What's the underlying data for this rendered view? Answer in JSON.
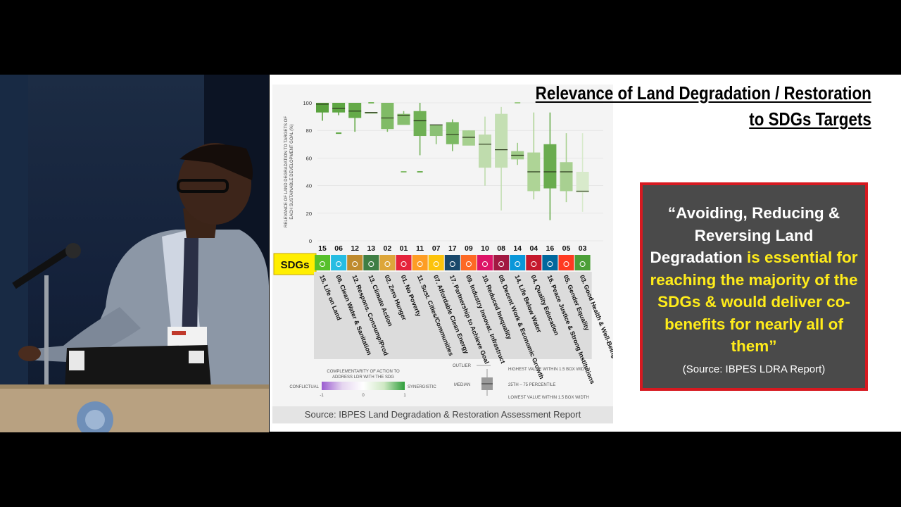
{
  "slide": {
    "title_line1": "Relevance of Land Degradation / Restoration",
    "title_line2": "to SDGs Targets",
    "source": "Source: IBPES Land Degradation & Restoration Assessment Report",
    "quote": {
      "white_part": "“Avoiding, Reducing & Reversing Land Degradation",
      "yellow_part": " is essential for reaching the majority of the SDGs & would deliver co-benefits for nearly all of them",
      "close_mark": "”",
      "source": "(Source: IBPES LDRA Report)"
    }
  },
  "chart_data": {
    "type": "box",
    "ylabel": "RELEVANCE OF LAND DEGRADATION TO TARGETS OF EACH SUSTAINABLE DEVELOPMENT GOAL (%)",
    "ylim": [
      0,
      100
    ],
    "yticks": [
      "0",
      "20",
      "40",
      "60",
      "80",
      "100"
    ],
    "sdg_row_label": "SDGs",
    "categories": [
      "15",
      "06",
      "12",
      "13",
      "02",
      "01",
      "11",
      "07",
      "17",
      "09",
      "10",
      "08",
      "14",
      "04",
      "16",
      "05",
      "03"
    ],
    "names": [
      "15. Life on Land",
      "06. Clean Water & Sanitation",
      "12. Respons. Consump/Prod",
      "13. Climate Action",
      "02. Zero Hunger",
      "01. No Poverty",
      "11. Sust. Cities/Communities",
      "07. Affordable Clean Energy",
      "17. Partnership to Achieve Goal",
      "09. Industry Innovat. Infrastruct",
      "10. Reduced Inequality",
      "08. Decent Work & Economic Growth",
      "14. Life Below Water",
      "04. Quality Education",
      "16. Peace Justice & Strong Institutions",
      "05. Gender Equality",
      "03. Good Health & Well-Being"
    ],
    "sdg_colors": [
      "#56c02b",
      "#26bde2",
      "#bf8b2e",
      "#3f7e44",
      "#dda63a",
      "#e5243b",
      "#fd9d24",
      "#fcc30b",
      "#19486a",
      "#fd6925",
      "#dd1367",
      "#a21942",
      "#0a97d9",
      "#c5192d",
      "#00689d",
      "#ff3a21",
      "#4c9f38"
    ],
    "box_colors": [
      "#5aa23e",
      "#5ea643",
      "#64aa48",
      "#79b75e",
      "#80bb66",
      "#86be6d",
      "#6fb054",
      "#8cc176",
      "#7cb964",
      "#a6d08f",
      "#bfdcad",
      "#c4dfb3",
      "#9fcc88",
      "#aed496",
      "#6aac4f",
      "#a8d091",
      "#d8eacb"
    ],
    "boxes": [
      {
        "min": 87,
        "q1": 93,
        "median": 99,
        "q3": 100,
        "max": 100,
        "outliers": []
      },
      {
        "min": 91,
        "q1": 93,
        "median": 96,
        "q3": 100,
        "max": 100,
        "outliers": [
          78
        ]
      },
      {
        "min": 79,
        "q1": 89,
        "median": 94,
        "q3": 100,
        "max": 100,
        "outliers": []
      },
      {
        "min": 93,
        "q1": 93,
        "median": 93,
        "q3": 93,
        "max": 93,
        "outliers": [
          100
        ]
      },
      {
        "min": 79,
        "q1": 81,
        "median": 89,
        "q3": 100,
        "max": 100,
        "outliers": []
      },
      {
        "min": 85,
        "q1": 84,
        "median": 91,
        "q3": 92,
        "max": 94,
        "outliers": [
          50
        ]
      },
      {
        "min": 62,
        "q1": 76,
        "median": 87,
        "q3": 94,
        "max": 100,
        "outliers": [
          50
        ]
      },
      {
        "min": 70,
        "q1": 76,
        "median": 84,
        "q3": 84,
        "max": 84,
        "outliers": []
      },
      {
        "min": 65,
        "q1": 70,
        "median": 77,
        "q3": 86,
        "max": 88,
        "outliers": []
      },
      {
        "min": 70,
        "q1": 69,
        "median": 75,
        "q3": 80,
        "max": 80,
        "outliers": []
      },
      {
        "min": 40,
        "q1": 53,
        "median": 70,
        "q3": 77,
        "max": 90,
        "outliers": []
      },
      {
        "min": 22,
        "q1": 53,
        "median": 66,
        "q3": 92,
        "max": 97,
        "outliers": []
      },
      {
        "min": 55,
        "q1": 59,
        "median": 62,
        "q3": 65,
        "max": 71,
        "outliers": [
          100
        ]
      },
      {
        "min": 30,
        "q1": 36,
        "median": 50,
        "q3": 64,
        "max": 93,
        "outliers": []
      },
      {
        "min": 15,
        "q1": 38,
        "median": 50,
        "q3": 70,
        "max": 93,
        "outliers": []
      },
      {
        "min": 28,
        "q1": 36,
        "median": 50,
        "q3": 57,
        "max": 78,
        "outliers": []
      },
      {
        "min": 21,
        "q1": 35,
        "median": 36,
        "q3": 50,
        "max": 78,
        "outliers": []
      }
    ],
    "color_legend": {
      "title_line1": "COMPLEMENTARITY OF ACTION TO",
      "title_line2": "ADDRESS LDR WITH THE SDG",
      "left_label": "CONFLICTUAL",
      "right_label": "SYNERGISTIC",
      "ticks": [
        "-1",
        "0",
        "1"
      ],
      "gradient": [
        "#9a5bd0",
        "#e6d6f0",
        "#ffffff",
        "#cfe8c4",
        "#2e9e3a"
      ]
    },
    "box_legend": {
      "outlier": "OUTLIER",
      "median": "MEDIAN",
      "highest": "HIGHEST VALUE WITHIN 1.5 BOX WIDTH",
      "percentile": "25TH – 75 PERCENTILE",
      "lowest": "LOWEST VALUE WITHIN 1.5 BOX WIDTH"
    }
  }
}
